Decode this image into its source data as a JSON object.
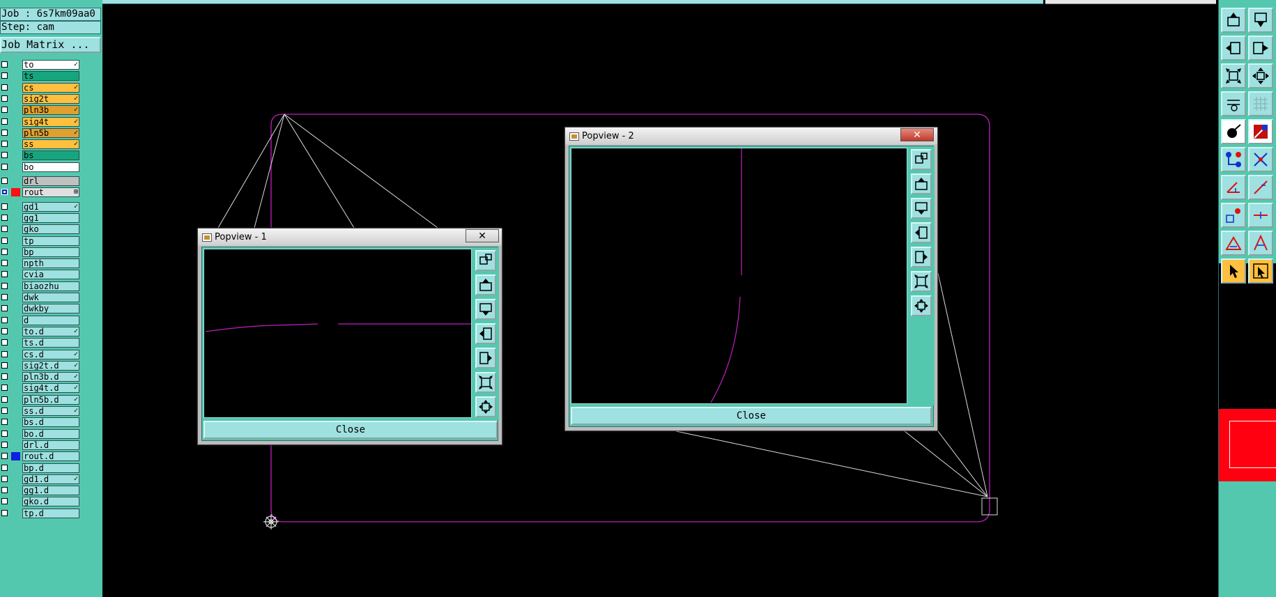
{
  "job_label": "Job : 6s7km09aa0",
  "step_label": "Step: cam",
  "job_matrix_button": "Job Matrix ...",
  "layers": [
    {
      "name": "to",
      "color": "#ffffff",
      "mark": "✓",
      "checked": false
    },
    {
      "name": "ts",
      "color": "#16a67e",
      "mark": "",
      "checked": false
    },
    {
      "name": "cs",
      "color": "#ffbf3f",
      "mark": "✓",
      "checked": false
    },
    {
      "name": "sig2t",
      "color": "#ffbf3f",
      "mark": "✓",
      "checked": false
    },
    {
      "name": "pln3b",
      "color": "#e0a030",
      "mark": "✓",
      "checked": false
    },
    {
      "name": "sig4t",
      "color": "#ffbf3f",
      "mark": "✓",
      "checked": false
    },
    {
      "name": "pln5b",
      "color": "#e0a030",
      "mark": "✓",
      "checked": false
    },
    {
      "name": "ss",
      "color": "#ffbf3f",
      "mark": "✓",
      "checked": false
    },
    {
      "name": "bs",
      "color": "#16a67e",
      "mark": "",
      "checked": false
    },
    {
      "name": "bo",
      "color": "#ffffff",
      "mark": "",
      "checked": false
    },
    {
      "name": "drl",
      "color": "#c0c0c0",
      "mark": "",
      "checked": false,
      "gap": true
    },
    {
      "name": "rout",
      "color": "#e0e0e0",
      "mark": "⊞",
      "checked": true,
      "swatch": "#ff1010"
    },
    {
      "name": "gd1",
      "color": "#9fe0e0",
      "mark": "✓",
      "checked": false,
      "gap": true
    },
    {
      "name": "gg1",
      "color": "#9fe0e0",
      "mark": "",
      "checked": false
    },
    {
      "name": "gko",
      "color": "#9fe0e0",
      "mark": "",
      "checked": false
    },
    {
      "name": "tp",
      "color": "#9fe0e0",
      "mark": "",
      "checked": false
    },
    {
      "name": "bp",
      "color": "#9fe0e0",
      "mark": "",
      "checked": false
    },
    {
      "name": "npth",
      "color": "#9fe0e0",
      "mark": "",
      "checked": false
    },
    {
      "name": "cvia",
      "color": "#9fe0e0",
      "mark": "",
      "checked": false
    },
    {
      "name": "biaozhu",
      "color": "#9fe0e0",
      "mark": "",
      "checked": false
    },
    {
      "name": "dwk",
      "color": "#9fe0e0",
      "mark": "",
      "checked": false
    },
    {
      "name": "dwkby",
      "color": "#9fe0e0",
      "mark": "",
      "checked": false
    },
    {
      "name": "d",
      "color": "#9fe0e0",
      "mark": "",
      "checked": false
    },
    {
      "name": "to.d",
      "color": "#9fe0e0",
      "mark": "✓",
      "checked": false
    },
    {
      "name": "ts.d",
      "color": "#9fe0e0",
      "mark": "",
      "checked": false
    },
    {
      "name": "cs.d",
      "color": "#9fe0e0",
      "mark": "✓",
      "checked": false
    },
    {
      "name": "sig2t.d",
      "color": "#9fe0e0",
      "mark": "✓",
      "checked": false
    },
    {
      "name": "pln3b.d",
      "color": "#9fe0e0",
      "mark": "✓",
      "checked": false
    },
    {
      "name": "sig4t.d",
      "color": "#9fe0e0",
      "mark": "✓",
      "checked": false
    },
    {
      "name": "pln5b.d",
      "color": "#9fe0e0",
      "mark": "✓",
      "checked": false
    },
    {
      "name": "ss.d",
      "color": "#9fe0e0",
      "mark": "✓",
      "checked": false
    },
    {
      "name": "bs.d",
      "color": "#9fe0e0",
      "mark": "",
      "checked": false
    },
    {
      "name": "bo.d",
      "color": "#9fe0e0",
      "mark": "",
      "checked": false
    },
    {
      "name": "drl.d",
      "color": "#9fe0e0",
      "mark": "",
      "checked": false
    },
    {
      "name": "rout.d",
      "color": "#9fe0e0",
      "mark": "",
      "checked": false,
      "swatch": "#1020e0"
    },
    {
      "name": "bp.d",
      "color": "#9fe0e0",
      "mark": "",
      "checked": false
    },
    {
      "name": "gd1.d",
      "color": "#9fe0e0",
      "mark": "✓",
      "checked": false
    },
    {
      "name": "gg1.d",
      "color": "#9fe0e0",
      "mark": "",
      "checked": false
    },
    {
      "name": "gko.d",
      "color": "#9fe0e0",
      "mark": "",
      "checked": false
    },
    {
      "name": "tp.d",
      "color": "#9fe0e0",
      "mark": "",
      "checked": false
    }
  ],
  "popview1": {
    "title": "Popview - 1",
    "close_label": "Close"
  },
  "popview2": {
    "title": "Popview - 2",
    "close_label": "Close"
  },
  "toolbar_icons": [
    "move-up-icon",
    "move-down-icon",
    "move-left-icon",
    "move-right-icon",
    "fit-zoom-icon",
    "center-zoom-icon",
    "measure-icon",
    "grid-icon",
    "snap-icon",
    "pad-icon",
    "connect-icon",
    "intersect-icon",
    "angle-icon",
    "line-angle-icon",
    "offset-icon",
    "line-icon",
    "triangle-icon",
    "arrow-triangle-icon",
    "select-pointer-icon",
    "select-box-icon"
  ],
  "colors": {
    "panel": "#54c8ae",
    "panel_light": "#9fe0e0",
    "profile": "#c020c0",
    "accent": "#ffbf3f",
    "preview": "#ff0010"
  }
}
